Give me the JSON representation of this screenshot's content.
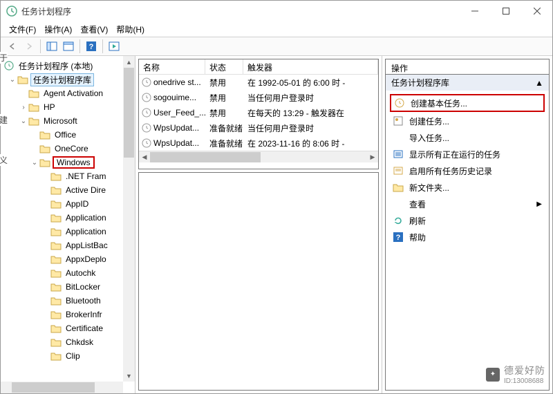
{
  "title": "任务计划程序",
  "menu": {
    "file": "文件(F)",
    "action": "操作(A)",
    "view": "查看(V)",
    "help": "帮助(H)"
  },
  "tree": {
    "root": "任务计划程序 (本地)",
    "lib": "任务计划程序库",
    "agent": "Agent Activation",
    "hp": "HP",
    "ms": "Microsoft",
    "office": "Office",
    "onecore": "OneCore",
    "windows": "Windows",
    "children": [
      ".NET Fram",
      "Active Dire",
      "AppID",
      "Application",
      "Application",
      "AppListBac",
      "AppxDeplo",
      "Autochk",
      "BitLocker",
      "Bluetooth",
      "BrokerInfr",
      "Certificate",
      "Chkdsk",
      "Clip"
    ]
  },
  "list": {
    "head": {
      "name": "名称",
      "state": "状态",
      "trig": "触发器"
    },
    "rows": [
      {
        "name": "onedrive st...",
        "state": "禁用",
        "trig": "在 1992-05-01 的 6:00 时 -"
      },
      {
        "name": "sogouime...",
        "state": "禁用",
        "trig": "当任何用户登录时"
      },
      {
        "name": "User_Feed_...",
        "state": "禁用",
        "trig": "在每天的 13:29 - 触发器在"
      },
      {
        "name": "WpsUpdat...",
        "state": "准备就绪",
        "trig": "当任何用户登录时"
      },
      {
        "name": "WpsUpdat...",
        "state": "准备就绪",
        "trig": "在 2023-11-16 的 8:06 时 -"
      }
    ]
  },
  "actions": {
    "title": "操作",
    "cat": "任务计划程序库",
    "items": {
      "create_basic": "创建基本任务...",
      "create": "创建任务...",
      "import": "导入任务...",
      "show_running": "显示所有正在运行的任务",
      "enable_hist": "启用所有任务历史记录",
      "new_folder": "新文件夹...",
      "view": "查看",
      "refresh": "刷新",
      "help": "帮助"
    }
  },
  "watermark": {
    "name": "德爱好防",
    "id": "ID:13008688"
  }
}
